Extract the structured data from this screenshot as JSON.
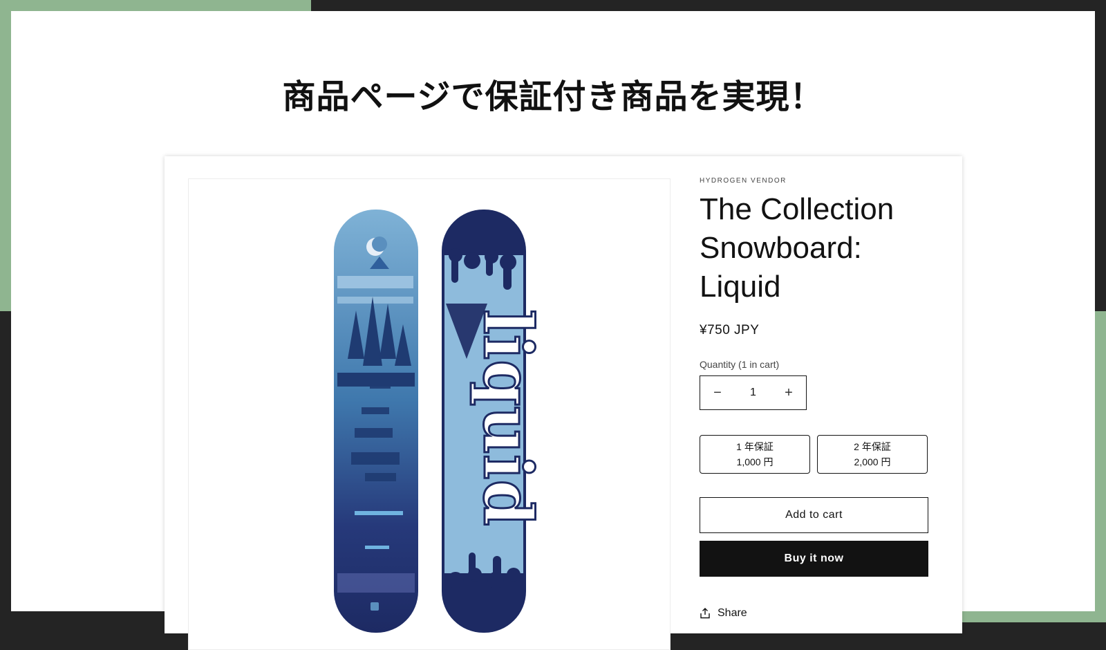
{
  "slide": {
    "headline": "商品ページで保証付き商品を実現！"
  },
  "product": {
    "vendor": "HYDROGEN VENDOR",
    "title": "The Collection Snowboard: Liquid",
    "price": "¥750 JPY",
    "quantity_label": "Quantity (1 in cart)",
    "quantity_value": "1",
    "decrease_symbol": "−",
    "increase_symbol": "+",
    "warranty_options": [
      {
        "term": "1 年保証",
        "price": "1,000 円"
      },
      {
        "term": "2 年保証",
        "price": "2,000 円"
      }
    ],
    "add_to_cart_label": "Add to cart",
    "buy_now_label": "Buy it now",
    "share_label": "Share"
  },
  "image": {
    "board_right_lettering": "liquid"
  },
  "colors": {
    "accent_green": "#8fb590",
    "dark_frame": "#242424",
    "text": "#121212",
    "buy_button": "#121212",
    "board_light_blue": "#6fa3c9",
    "board_navy": "#1d2a63"
  },
  "icons": {
    "share": "share-icon"
  }
}
